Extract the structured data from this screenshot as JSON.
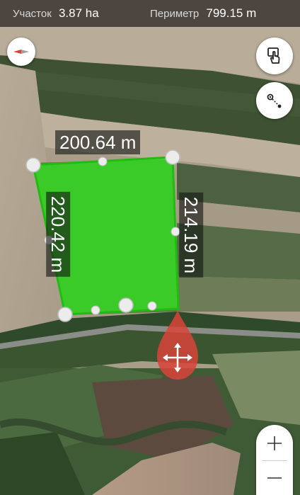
{
  "topbar": {
    "area_label": "Участок",
    "area_value": "3.87 ha",
    "perimeter_label": "Периметр",
    "perimeter_value": "799.15 m"
  },
  "segments": {
    "top": "200.64 m",
    "left": "220.42 m",
    "right": "214.19 m"
  },
  "icons": {
    "compass": "compass-icon",
    "hand_tool": "hand-pointer-icon",
    "measure_tool": "distance-measure-icon",
    "move": "move-arrows-icon",
    "zoom_in": "plus-icon",
    "zoom_out": "minus-icon"
  },
  "colors": {
    "polygon_fill": "#33dd22",
    "polygon_stroke": "#22bb11",
    "move_pin": "#d9443a",
    "topbar_bg": "#2d2826"
  }
}
